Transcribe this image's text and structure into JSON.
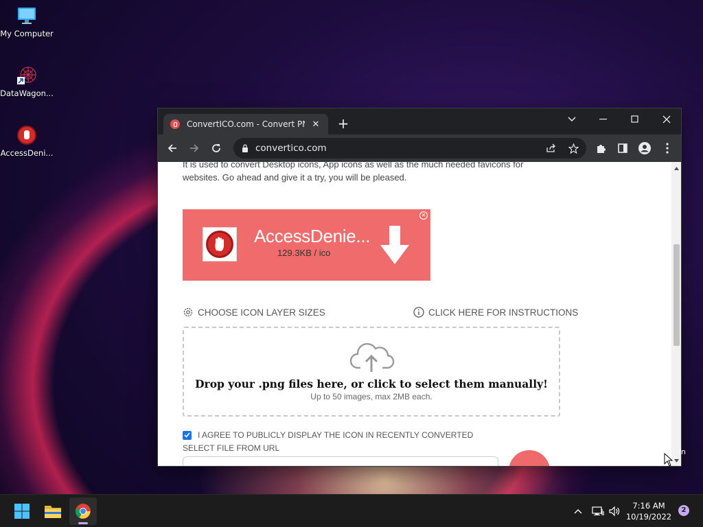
{
  "desktop": {
    "icons": [
      {
        "label": "My Computer"
      },
      {
        "label": "DataWagon..."
      },
      {
        "label": "AccessDeni..."
      }
    ],
    "edge_text": "in"
  },
  "browser": {
    "tab_title": "ConvertICO.com - Convert PNG t",
    "url": "convertico.com"
  },
  "page": {
    "intro_line1": "It is used to convert Desktop icons, App icons as well as the much needed favicons for",
    "intro_line2": "websites. Go ahead and give it a try, you will be pleased.",
    "converted": {
      "name": "AccessDenie...",
      "size": "129.3KB / ico"
    },
    "choose_sizes": "CHOOSE ICON LAYER SIZES",
    "instructions": "CLICK HERE FOR INSTRUCTIONS",
    "dropzone_title": "Drop your .png files here, or click to select them manually!",
    "dropzone_sub": "Up to 50 images, max 2MB each.",
    "agree_label": "I AGREE TO PUBLICLY DISPLAY THE ICON IN RECENTLY CONVERTED",
    "agree_checked": true,
    "url_label": "SELECT FILE FROM URL",
    "url_value": ""
  },
  "taskbar": {
    "time": "7:16 AM",
    "date": "10/19/2022",
    "notification_count": "2"
  },
  "colors": {
    "banner": "#f06b6b",
    "accent": "#1a73e8",
    "chrome_dark": "#202124",
    "chrome_toolbar": "#35363a"
  }
}
